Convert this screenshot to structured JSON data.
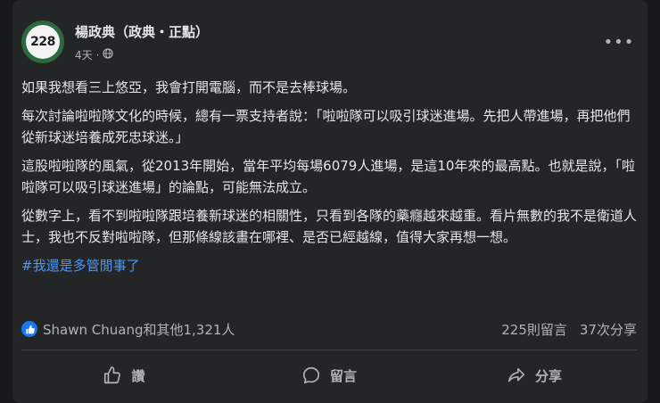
{
  "post": {
    "author": "楊政典（政典・正點）",
    "timestamp": "4天",
    "avatar_text": "228",
    "privacy_icon": "globe-icon",
    "paragraphs": [
      "如果我想看三上悠亞，我會打開電腦，而不是去棒球場。",
      "每次討論啦啦隊文化的時候，總有一票支持者說：「啦啦隊可以吸引球迷進場。先把人帶進場，再把他們從新球迷培養成死忠球迷。」",
      "這股啦啦隊的風氣，從2013年開始，當年平均每場6079人進場，是這10年來的最高點。也就是說，「啦啦隊可以吸引球迷進場」的論點，可能無法成立。",
      "從數字上，看不到啦啦隊跟培養新球迷的相關性，只看到各隊的藥癮越來越重。看片無數的我不是衛道人士，我也不反對啦啦隊，但那條線該畫在哪裡、是否已經越線，值得大家再想一想。"
    ],
    "hashtag": "#我還是多管閒事了"
  },
  "reactions": {
    "summary": "Shawn Chuang和其他1,321人",
    "comments": "225則留言",
    "shares": "37次分享"
  },
  "actions": {
    "like": "讚",
    "comment": "留言",
    "share": "分享"
  },
  "colors": {
    "background": "#18191a",
    "card": "#242526",
    "text": "#e4e6eb",
    "secondary": "#b0b3b8",
    "link": "#4599ff",
    "like_blue": "#1877f2"
  }
}
